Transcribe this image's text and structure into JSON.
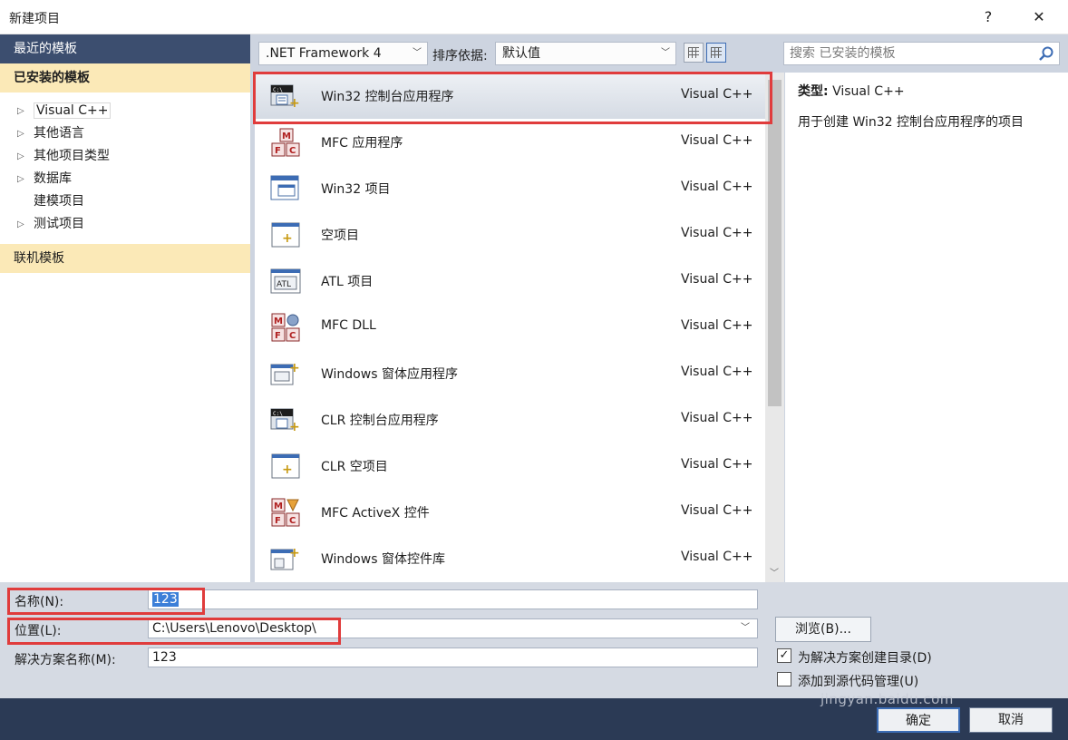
{
  "window": {
    "title": "新建项目",
    "help_glyph": "?",
    "close_glyph": "✕"
  },
  "sidebar": {
    "recent": "最近的模板",
    "installed": "已安装的模板",
    "tree": [
      {
        "label": "Visual C++",
        "has_arrow": true,
        "selected": true
      },
      {
        "label": "其他语言",
        "has_arrow": true
      },
      {
        "label": "其他项目类型",
        "has_arrow": true
      },
      {
        "label": "数据库",
        "has_arrow": true
      },
      {
        "label": "建模项目",
        "has_arrow": false
      },
      {
        "label": "测试项目",
        "has_arrow": true
      }
    ],
    "online": "联机模板"
  },
  "toolbar": {
    "framework": ".NET Framework 4",
    "sort_label": "排序依据:",
    "sort_value": "默认值",
    "search_placeholder": "搜索 已安装的模板"
  },
  "templates": [
    {
      "name": "Win32 控制台应用程序",
      "lang": "Visual C++",
      "icon": "console-app-icon",
      "selected": true
    },
    {
      "name": "MFC 应用程序",
      "lang": "Visual C++",
      "icon": "mfc-app-icon"
    },
    {
      "name": "Win32 项目",
      "lang": "Visual C++",
      "icon": "win32-project-icon"
    },
    {
      "name": "空项目",
      "lang": "Visual C++",
      "icon": "empty-project-icon"
    },
    {
      "name": "ATL 项目",
      "lang": "Visual C++",
      "icon": "atl-project-icon"
    },
    {
      "name": "MFC DLL",
      "lang": "Visual C++",
      "icon": "mfc-dll-icon"
    },
    {
      "name": "Windows 窗体应用程序",
      "lang": "Visual C++",
      "icon": "windows-forms-app-icon"
    },
    {
      "name": "CLR 控制台应用程序",
      "lang": "Visual C++",
      "icon": "clr-console-icon"
    },
    {
      "name": "CLR 空项目",
      "lang": "Visual C++",
      "icon": "clr-empty-icon"
    },
    {
      "name": "MFC ActiveX 控件",
      "lang": "Visual C++",
      "icon": "mfc-activex-icon"
    },
    {
      "name": "Windows 窗体控件库",
      "lang": "Visual C++",
      "icon": "windows-forms-control-icon"
    }
  ],
  "description": {
    "type_label": "类型:",
    "type_value": "Visual C++",
    "text": "用于创建 Win32 控制台应用程序的项目"
  },
  "form": {
    "name_label": "名称(N):",
    "name_value": "123",
    "location_label": "位置(L):",
    "location_value": "C:\\Users\\Lenovo\\Desktop\\",
    "solution_label": "解决方案名称(M):",
    "solution_value": "123",
    "browse": "浏览(B)...",
    "create_dir_label": "为解决方案创建目录(D)",
    "create_dir_checked": true,
    "add_source_control_label": "添加到源代码管理(U)",
    "add_source_control_checked": false
  },
  "buttons": {
    "ok": "确定",
    "cancel": "取消"
  },
  "watermark": "jingyan.baidu.com",
  "colors": {
    "sidebar_header": "#3c4e6f",
    "installed_highlight": "#fbe9b7",
    "highlight_box": "#e03c3c",
    "selection": "#3c7fd8"
  }
}
